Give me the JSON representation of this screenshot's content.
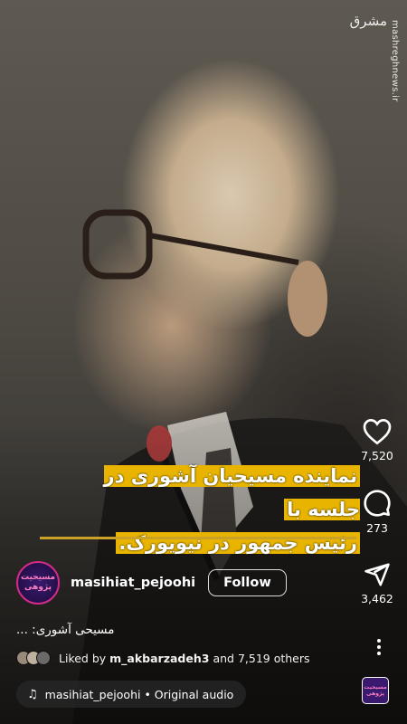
{
  "watermark": {
    "logo": "مشرق",
    "url": "mashreghnews.ir"
  },
  "video": {
    "caption_line1_pre": "نماینده مسیحیان آشوری در جلسه با",
    "caption_line2": "رئیس جمهور در نیویورک."
  },
  "actions": {
    "likes": "7,520",
    "comments": "273",
    "shares": "3,462"
  },
  "author": {
    "avatar_text": "مسیحیت پژوهی",
    "username": "masihiat_pejoohi",
    "follow_label": "Follow"
  },
  "post": {
    "description": "مسیحی آشوری: ...",
    "liked_prefix": "Liked by",
    "liked_user": "m_akbarzadeh3",
    "liked_suffix": "and 7,519 others"
  },
  "audio": {
    "label": "masihiat_pejoohi • Original audio",
    "thumb_text": "مسیحیت پژوهی"
  },
  "icons": {
    "like": "heart-icon",
    "comment": "comment-bubble-icon",
    "share": "paper-plane-icon",
    "more": "more-vertical-icon",
    "audio": "music-note-icon"
  }
}
